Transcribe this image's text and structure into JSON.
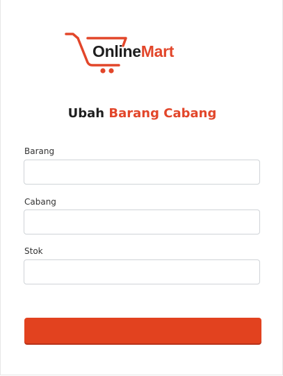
{
  "brand": {
    "online": "Online",
    "mart": "Mart",
    "accent_color": "#e2462a",
    "icon": "shopping-cart-icon"
  },
  "heading": {
    "prefix": "Ubah",
    "accent": "Barang Cabang"
  },
  "form": {
    "fields": [
      {
        "label": "Barang",
        "value": ""
      },
      {
        "label": "Cabang",
        "value": ""
      },
      {
        "label": "Stok",
        "value": ""
      }
    ],
    "submit_label": ""
  }
}
